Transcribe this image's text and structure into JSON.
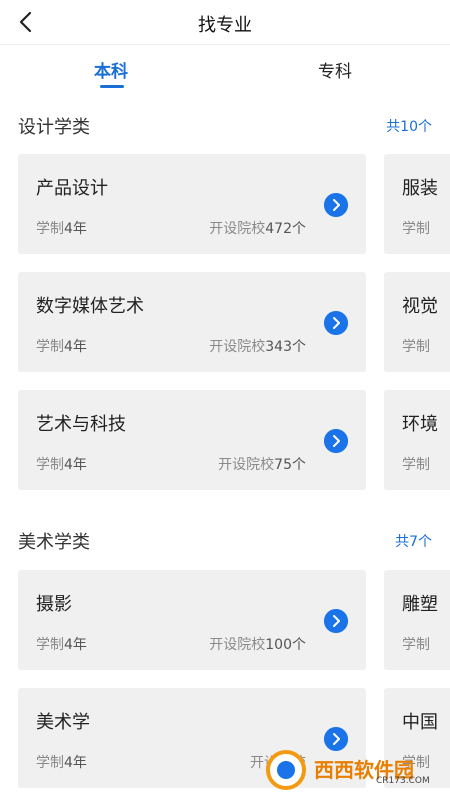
{
  "header": {
    "title": "找专业",
    "back_icon": "chevron-left-icon"
  },
  "tabs": [
    {
      "label": "本科",
      "active": true
    },
    {
      "label": "专科",
      "active": false
    }
  ],
  "sections": [
    {
      "title": "设计学类",
      "count": "共10个",
      "cards": [
        {
          "name": "产品设计",
          "duration_label": "学制",
          "duration": "4年",
          "schools_label": "开设院校",
          "schools": "472个"
        },
        {
          "name": "数字媒体艺术",
          "duration_label": "学制",
          "duration": "4年",
          "schools_label": "开设院校",
          "schools": "343个"
        },
        {
          "name": "艺术与科技",
          "duration_label": "学制",
          "duration": "4年",
          "schools_label": "开设院校",
          "schools": "75个"
        }
      ],
      "peek_cards": [
        {
          "name": "服装",
          "duration_label": "学制"
        },
        {
          "name": "视觉",
          "duration_label": "学制"
        },
        {
          "name": "环境",
          "duration_label": "学制"
        }
      ]
    },
    {
      "title": "美术学类",
      "count": "共7个",
      "cards": [
        {
          "name": "摄影",
          "duration_label": "学制",
          "duration": "4年",
          "schools_label": "开设院校",
          "schools": "100个"
        },
        {
          "name": "美术学",
          "duration_label": "学制",
          "duration": "4年",
          "schools_label": "开设院校",
          "schools": ""
        }
      ],
      "peek_cards": [
        {
          "name": "雕塑",
          "duration_label": "学制"
        },
        {
          "name": "中国",
          "duration_label": "学制"
        }
      ]
    }
  ],
  "watermark": {
    "text": "西西软件园",
    "sub": "CR173.COM"
  },
  "colors": {
    "accent": "#1a6fd6",
    "card_bg": "#f0f0f0",
    "arrow_button": "#1a73e8"
  }
}
